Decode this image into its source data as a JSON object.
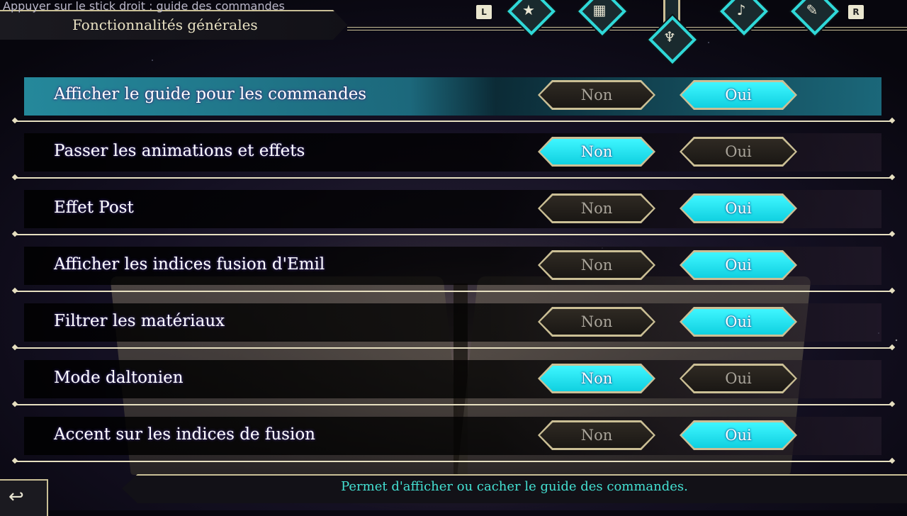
{
  "header": {
    "hint": "Appuyer sur le stick droit : guide des commandes",
    "title": "Fonctionnalités générales",
    "key_left": "L",
    "key_right": "R",
    "tabs": [
      {
        "icon": "star-icon",
        "glyph": "★",
        "active": false
      },
      {
        "icon": "grid-icon",
        "glyph": "▦",
        "active": false
      },
      {
        "icon": "emblem-icon",
        "glyph": "♆",
        "active": true
      },
      {
        "icon": "music-note-icon",
        "glyph": "♪",
        "active": false
      },
      {
        "icon": "wrench-icon",
        "glyph": "✎",
        "active": false
      }
    ]
  },
  "options": [
    {
      "label": "Afficher le guide pour les commandes",
      "non": "Non",
      "oui": "Oui",
      "value": "Oui",
      "selected": true
    },
    {
      "label": "Passer les animations et effets",
      "non": "Non",
      "oui": "Oui",
      "value": "Non",
      "selected": false
    },
    {
      "label": "Effet Post",
      "non": "Non",
      "oui": "Oui",
      "value": "Oui",
      "selected": false
    },
    {
      "label": "Afficher les indices fusion d'Emil",
      "non": "Non",
      "oui": "Oui",
      "value": "Oui",
      "selected": false
    },
    {
      "label": "Filtrer les matériaux",
      "non": "Non",
      "oui": "Oui",
      "value": "Oui",
      "selected": false
    },
    {
      "label": "Mode daltonien",
      "non": "Non",
      "oui": "Oui",
      "value": "Non",
      "selected": false
    },
    {
      "label": "Accent sur les indices de fusion",
      "non": "Non",
      "oui": "Oui",
      "value": "Oui",
      "selected": false
    }
  ],
  "footer": {
    "back_icon": "back-arrow-icon",
    "description": "Permet d'afficher ou cacher le guide des commandes."
  },
  "colors": {
    "accent_on": "#10d0e0",
    "frame": "#c9bf96",
    "description_text": "#44e0d2"
  }
}
